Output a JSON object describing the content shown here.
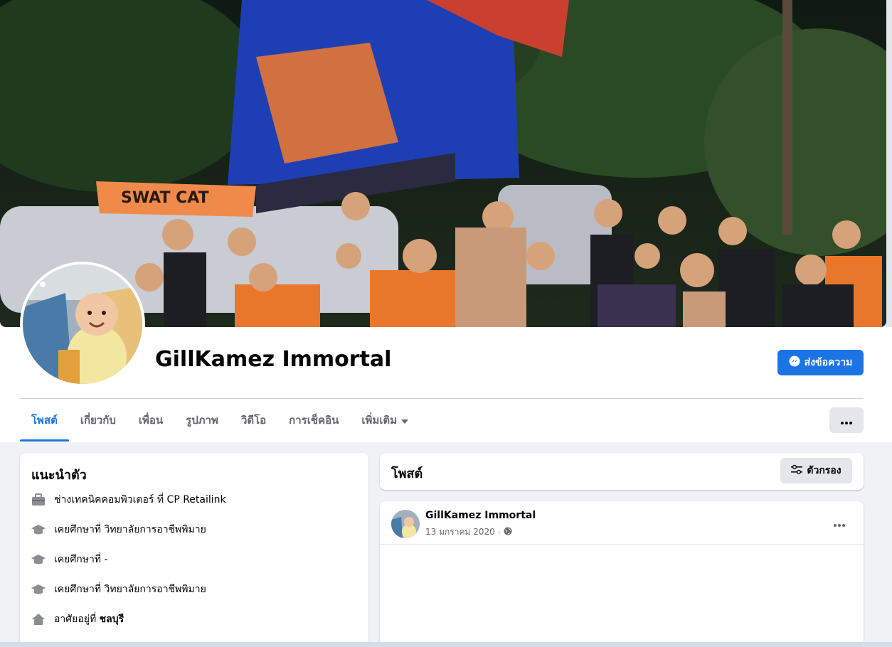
{
  "profile": {
    "name": "GillKamez Immortal",
    "message_button": "ส่งข้อความ"
  },
  "cover": {
    "flag_text": "SWAT CAT"
  },
  "tabs": [
    {
      "label": "โพสต์",
      "active": true
    },
    {
      "label": "เกี่ยวกับ"
    },
    {
      "label": "เพื่อน"
    },
    {
      "label": "รูปภาพ"
    },
    {
      "label": "วิดีโอ"
    },
    {
      "label": "การเช็คอิน"
    },
    {
      "label": "เพิ่มเติม",
      "icon": "caret-down-icon"
    }
  ],
  "intro": {
    "title": "แนะนำตัว",
    "items": [
      {
        "icon": "briefcase-icon",
        "text": "ช่างเทคนิคคอมพิวเตอร์ ที่ CP Retailink"
      },
      {
        "icon": "graduation-cap-icon",
        "text": "เคยศึกษาที่ วิทยาลัยการอาชีพพิมาย"
      },
      {
        "icon": "graduation-cap-icon",
        "text": "เคยศึกษาที่ -"
      },
      {
        "icon": "graduation-cap-icon",
        "text": "เคยศึกษาที่ วิทยาลัยการอาชีพพิมาย"
      },
      {
        "icon": "home-icon",
        "text": "อาศัยอยู่ที่",
        "bold": "ชลบุรี"
      }
    ]
  },
  "posts": {
    "title": "โพสต์",
    "filter_label": "ตัวกรอง",
    "items": [
      {
        "author": "GillKamez Immortal",
        "date": "13 มกราคม 2020",
        "separator": "·",
        "privacy_icon": "globe-icon"
      }
    ]
  },
  "colors": {
    "accent": "#1b74e4",
    "background": "#f0f2f5",
    "secondary_text": "#65676b",
    "button_gray": "#e4e6eb"
  }
}
